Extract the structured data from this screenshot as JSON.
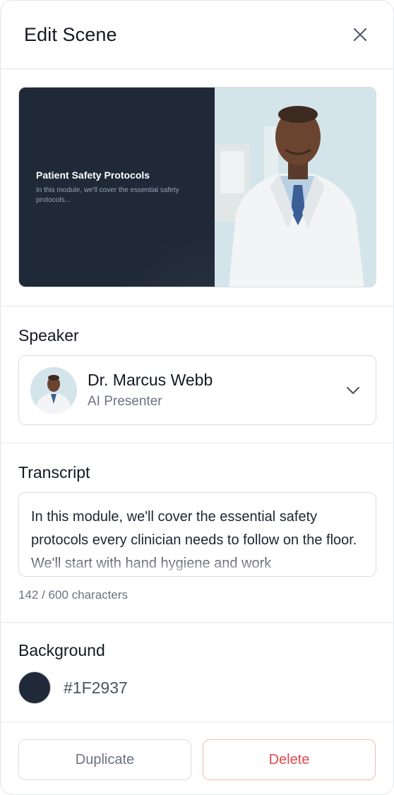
{
  "header": {
    "title": "Edit Scene",
    "close_icon": "close-icon"
  },
  "preview": {
    "slide_title": "Patient Safety Protocols",
    "slide_subtitle": "In this module, we'll cover the essential safety protocols...",
    "slide_background": "#1F2937"
  },
  "speaker": {
    "label": "Speaker",
    "name": "Dr. Marcus Webb",
    "role": "AI Presenter",
    "dropdown_icon": "chevron-down-icon"
  },
  "transcript": {
    "label": "Transcript",
    "text": "In this module, we'll cover the essential safety protocols every clinician needs to follow on the floor. We'll start with hand hygiene and work",
    "char_count": "142 / 600 characters"
  },
  "background": {
    "label": "Background",
    "color": "#1F2937",
    "hex_label": "#1F2937"
  },
  "actions": {
    "duplicate_label": "Duplicate",
    "delete_label": "Delete"
  },
  "colors": {
    "accent_danger": "#E5484D",
    "border": "#D9DCE3",
    "muted_text": "#6B7280"
  }
}
